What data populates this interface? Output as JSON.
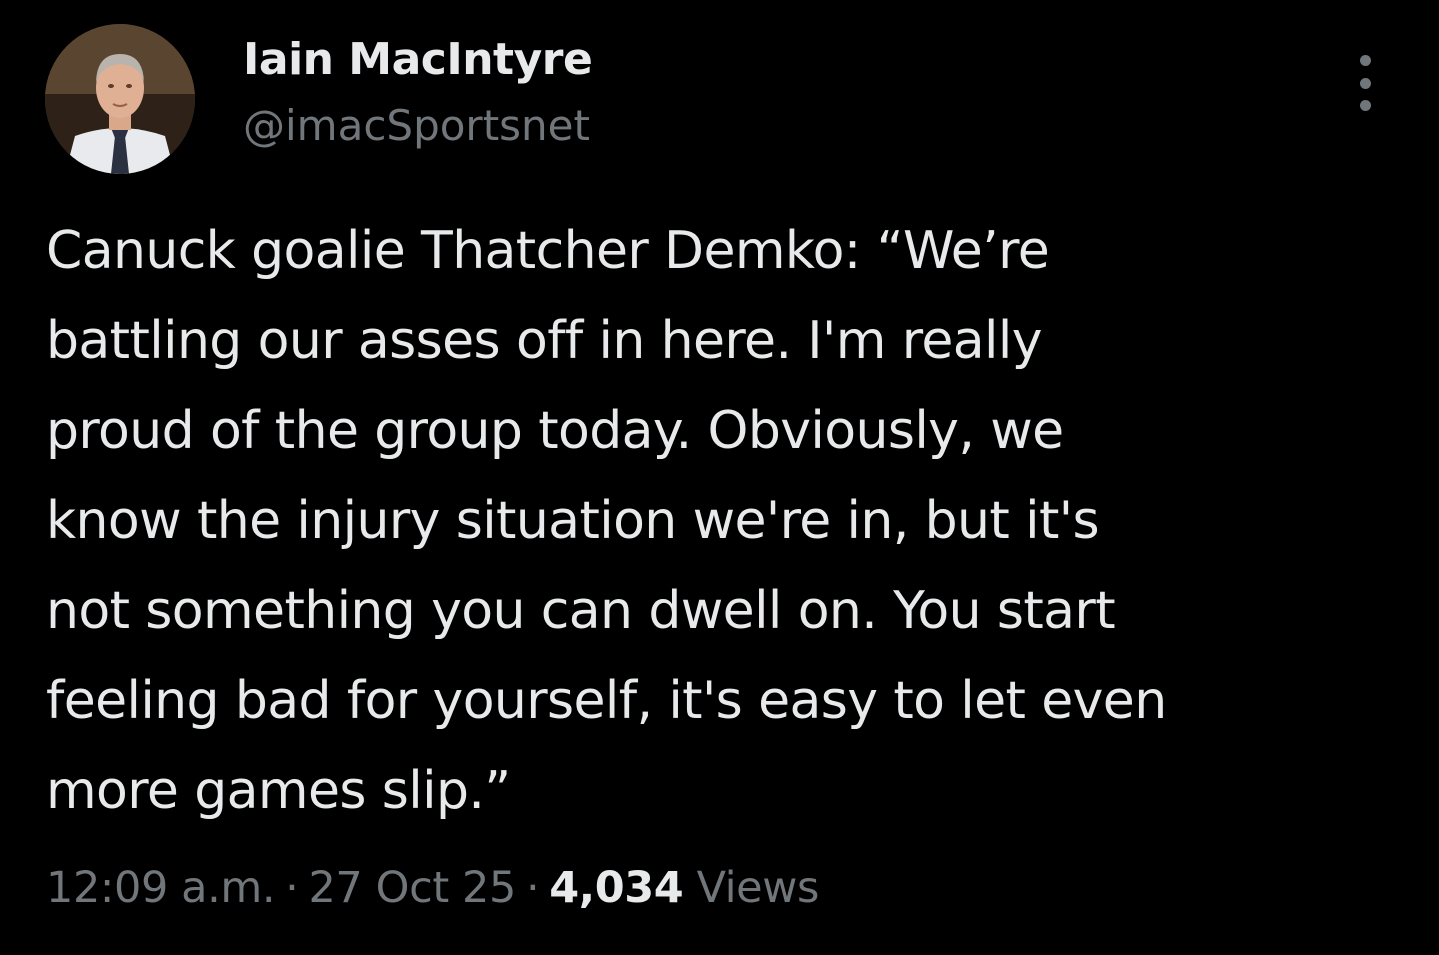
{
  "author": {
    "display_name": "Iain MacIntyre",
    "handle": "@imacSportsnet"
  },
  "tweet": {
    "text": "Canuck goalie Thatcher Demko: “We’re\nbattling our asses off in here. I'm really\nproud of the group today. Obviously, we\nknow the injury situation we're in, but it's\nnot something you can dwell on. You start\nfeeling bad for yourself, it's easy to let even\nmore games slip.”"
  },
  "meta": {
    "time": "12:09 a.m.",
    "date": "27 Oct 25",
    "separator": "·",
    "views_count": "4,034",
    "views_label": "Views"
  },
  "icons": {
    "more": "more-vertical-icon",
    "avatar": "profile-photo"
  },
  "colors": {
    "background": "#000000",
    "primary_text": "#e7e9ea",
    "secondary_text": "#71767b"
  }
}
